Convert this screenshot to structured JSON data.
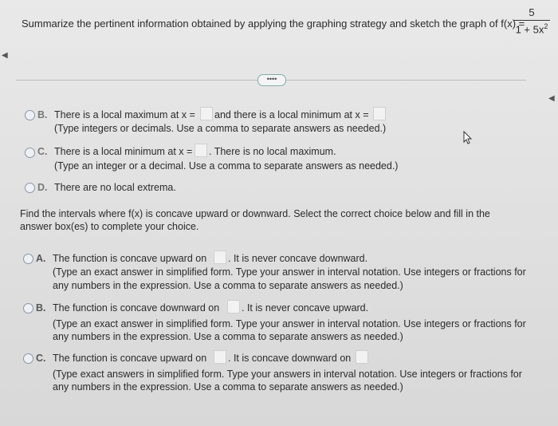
{
  "question": {
    "text": "Summarize the pertinent information obtained by applying the graphing strategy and sketch the graph of f(x) =",
    "numerator": "5",
    "denominator_base": "1 + 5x",
    "denominator_exp": "2"
  },
  "more_button": "••••",
  "part1": {
    "B": {
      "letter": "B.",
      "line1a": "There is a local maximum at x =",
      "line1b": "and there is a local minimum at x =",
      "line2": "(Type integers or decimals. Use a comma to separate answers as needed.)"
    },
    "C": {
      "letter": "C.",
      "line1a": "There is a local minimum at x =",
      "line1b": ". There is no local maximum.",
      "line2": "(Type an integer or a decimal. Use a comma to separate answers as needed.)"
    },
    "D": {
      "letter": "D.",
      "line1": "There are no local extrema."
    }
  },
  "part2": {
    "prompt1": "Find the intervals where f(x) is concave upward or downward. Select the correct choice below and fill in the",
    "prompt2": "answer box(es) to complete your choice.",
    "A": {
      "letter": "A.",
      "line1a": "The function is concave upward on",
      "line1b": ". It is never concave downward.",
      "line2": "(Type an exact answer in simplified form. Type your answer in interval notation. Use integers or fractions for",
      "line3": "any numbers in the expression. Use a comma to separate answers as needed.)"
    },
    "B": {
      "letter": "B.",
      "line1a": "The function is concave downward on",
      "line1b": ". It is never concave upward.",
      "line2": "(Type an exact answer in simplified form. Type your answer in interval notation. Use integers or fractions for",
      "line3": "any numbers in the expression. Use a comma to separate answers as needed.)"
    },
    "C": {
      "letter": "C.",
      "line1a": "The function is concave upward on",
      "line1b": ". It is concave downward on",
      "line2": "(Type exact answers in simplified form. Type your answers in interval notation. Use integers or fractions for",
      "line3": "any numbers in the expression. Use a comma to separate answers as needed.)"
    }
  }
}
